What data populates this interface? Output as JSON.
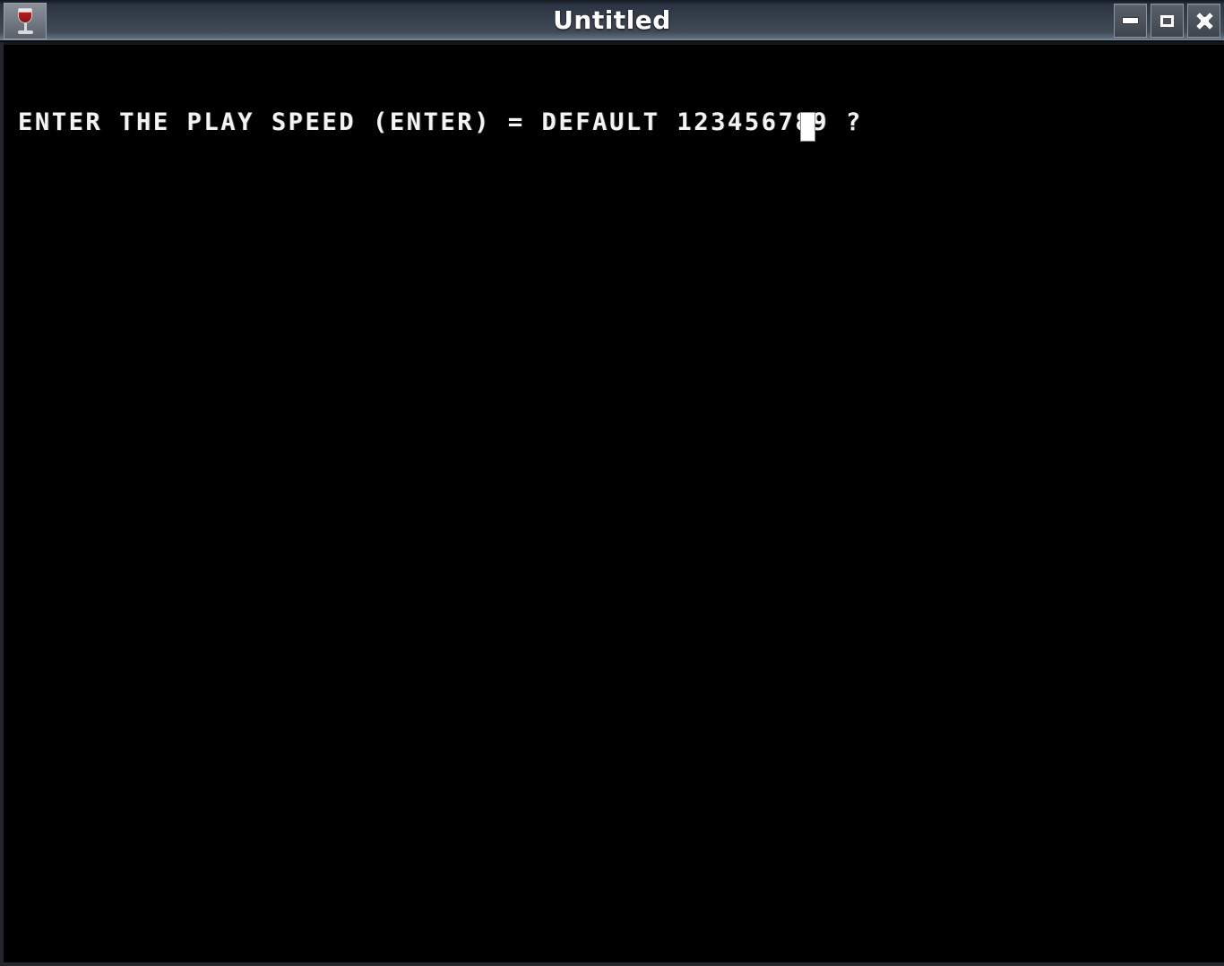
{
  "window": {
    "title": "Untitled",
    "app_icon": "wine-glass-icon",
    "titlebar_color": "#39434f",
    "client_background": "#000000",
    "border_color": "#23272b"
  },
  "window_controls": {
    "minimize": {
      "label": "Minimize",
      "icon": "minimize-icon",
      "glyph": "–"
    },
    "maximize": {
      "label": "Maximize",
      "icon": "maximize-icon",
      "glyph": "▢"
    },
    "close": {
      "label": "Close",
      "icon": "close-icon",
      "glyph": "✕"
    }
  },
  "console": {
    "text_color": "#f4f4f4",
    "prompt_line": "ENTER THE PLAY SPEED (ENTER) = DEFAULT 123456789 ? ",
    "prompt_parts": {
      "instruction": "ENTER THE PLAY SPEED",
      "default_hint": "(ENTER) = DEFAULT",
      "options": "123456789",
      "question_mark": "?"
    },
    "input_value": "",
    "cursor": {
      "type": "block",
      "visible": true,
      "color": "#ffffff"
    }
  }
}
